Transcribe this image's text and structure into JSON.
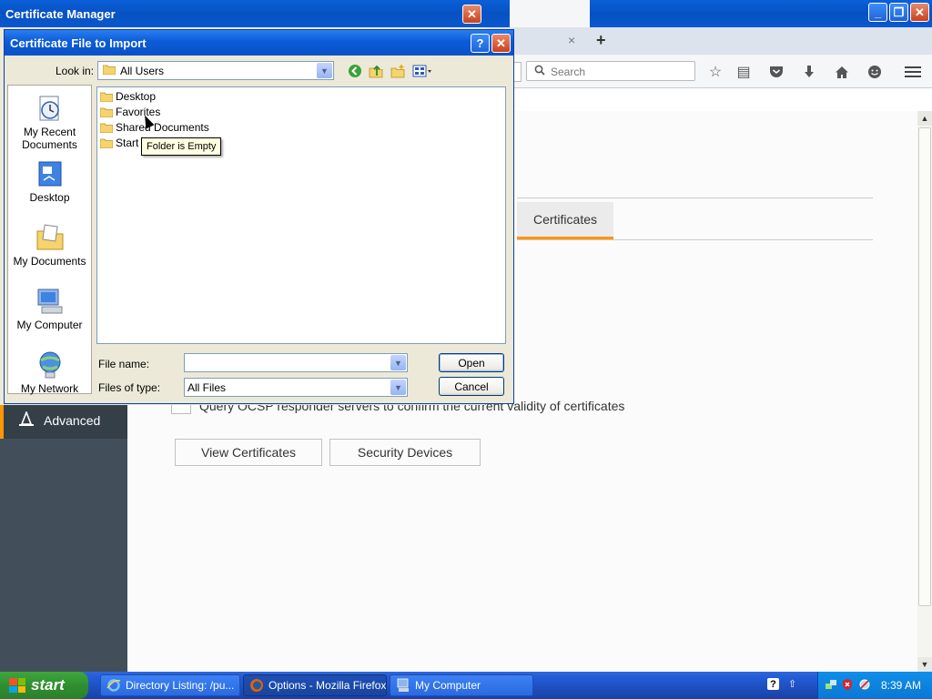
{
  "firefox": {
    "tab_close": "×",
    "new_tab": "+",
    "search_placeholder": "Search",
    "sidebar_advanced": "Advanced",
    "pref_tab_certificates": "Certificates",
    "ocsp_text": "Query OCSP responder servers to confirm the current validity of certificates",
    "view_certificates": "View Certificates",
    "security_devices": "Security Devices"
  },
  "cert_manager": {
    "title": "Certificate Manager"
  },
  "dialog": {
    "title": "Certificate File to Import",
    "look_in_label": "Look in:",
    "look_in_value": "All Users",
    "places": [
      {
        "label": "My Recent Documents"
      },
      {
        "label": "Desktop"
      },
      {
        "label": "My Documents"
      },
      {
        "label": "My Computer"
      },
      {
        "label": "My Network"
      }
    ],
    "files": [
      "Desktop",
      "Favorites",
      "Shared Documents",
      "Start Menu"
    ],
    "tooltip": "Folder is Empty",
    "file_name_label": "File name:",
    "file_name_value": "",
    "file_type_label": "Files of type:",
    "file_type_value": "All Files",
    "open_button": "Open",
    "cancel_button": "Cancel"
  },
  "taskbar": {
    "start": "start",
    "tasks": [
      {
        "label": "Directory Listing: /pu..."
      },
      {
        "label": "Options - Mozilla Firefox"
      },
      {
        "label": "My Computer"
      }
    ],
    "clock": "8:39 AM"
  },
  "colors": {
    "xp_title_blue": "#0752c2",
    "firefox_accent": "#ff9500",
    "xp_start_green": "#2f8f2f"
  }
}
